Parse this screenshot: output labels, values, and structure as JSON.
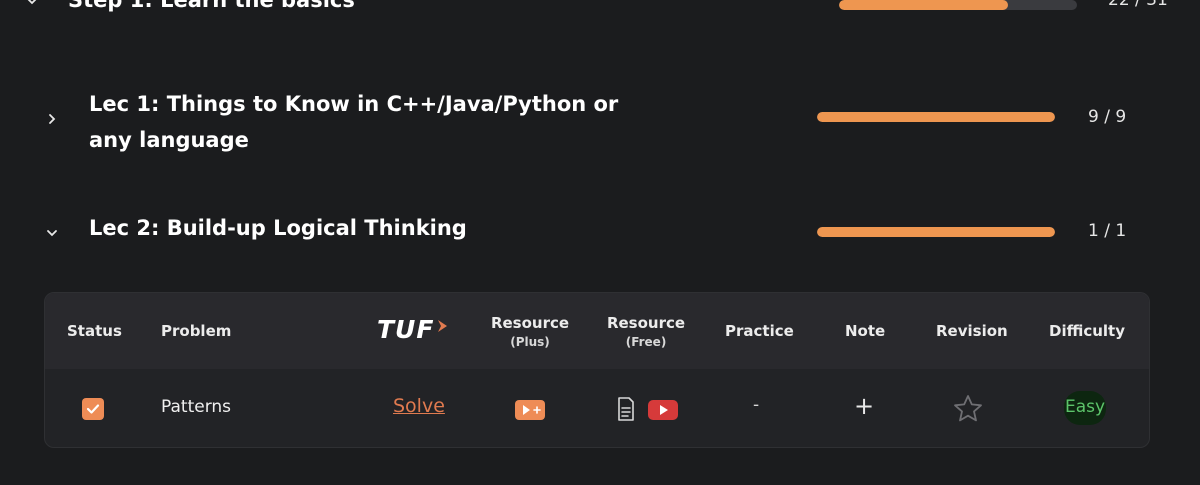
{
  "step": {
    "title": "Step 1: Learn the basics",
    "count": "22 / 31",
    "progress": 0.71
  },
  "lectures": [
    {
      "title_line1": "Lec 1: Things to Know in C++/Java/Python or",
      "title_line2": "any language",
      "count": "9 / 9",
      "progress": 1.0,
      "expanded": false
    },
    {
      "title": "Lec 2: Build-up Logical Thinking",
      "count": "1 / 1",
      "progress": 1.0,
      "expanded": true
    }
  ],
  "table": {
    "headers": {
      "status": "Status",
      "problem": "Problem",
      "tuf_logo": "TUF",
      "resource_plus": "Resource",
      "resource_plus_sub": "(Plus)",
      "resource_free": "Resource",
      "resource_free_sub": "(Free)",
      "practice": "Practice",
      "note": "Note",
      "revision": "Revision",
      "difficulty": "Difficulty"
    },
    "rows": [
      {
        "status": "checked",
        "problem": "Patterns",
        "solve": "Solve",
        "resource_plus_icon": "play-plus-icon",
        "resource_free_icons": [
          "article-icon",
          "youtube-icon"
        ],
        "practice": "-",
        "note": "+",
        "revision_icon": "star-outline-icon",
        "difficulty": "Easy"
      }
    ]
  },
  "colors": {
    "accent": "#ee9650",
    "background": "#1b1c1e",
    "easy": "#5cc46a",
    "youtube": "#d63a3a"
  }
}
